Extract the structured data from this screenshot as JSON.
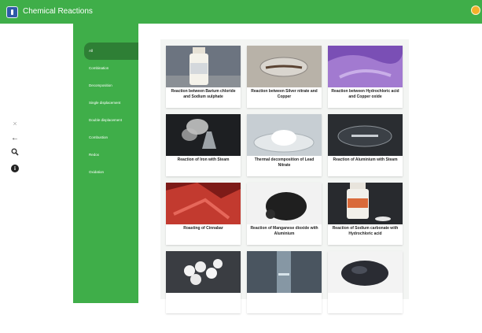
{
  "app": {
    "title": "Chemical Reactions",
    "colors": {
      "primary": "#3fae49",
      "active_item": "#2e7f35",
      "panel_bg": "#f3f5f3"
    }
  },
  "left_controls": [
    {
      "name": "close-icon",
      "symbol": "×"
    },
    {
      "name": "back-arrow-icon",
      "symbol": "←"
    },
    {
      "name": "search-icon",
      "symbol": "search"
    },
    {
      "name": "info-icon",
      "symbol": "i"
    }
  ],
  "categories": [
    {
      "label": "All",
      "active": true
    },
    {
      "label": "Combination",
      "active": false
    },
    {
      "label": "Decomposition",
      "active": false
    },
    {
      "label": "Single displacement",
      "active": false
    },
    {
      "label": "Double displacement",
      "active": false
    },
    {
      "label": "Combustion",
      "active": false
    },
    {
      "label": "Redox",
      "active": false
    },
    {
      "label": "Oxidation",
      "active": false
    }
  ],
  "reactions": [
    {
      "caption": "Reaction between Barium chloride and Sodium sulphate",
      "image": "barium-chloride-bottle"
    },
    {
      "caption": "Reaction between Silver nitrate and Copper",
      "image": "silver-nitrate-copper-dish"
    },
    {
      "caption": "Reaction between Hydrochloric acid and Copper oxide",
      "image": "purple-solution"
    },
    {
      "caption": "Reaction of Iron with Steam",
      "image": "steam-flask"
    },
    {
      "caption": "Thermal decomposition of Lead Nitrate",
      "image": "lead-nitrate-watch-glass"
    },
    {
      "caption": "Reaction of Aluminium with Steam",
      "image": "aluminium-dish"
    },
    {
      "caption": "Roasting of Cinnabar",
      "image": "cinnabar-red"
    },
    {
      "caption": "Reaction of Manganese dioxide with Aluminium",
      "image": "manganese-dioxide-powder"
    },
    {
      "caption": "Reaction of Sodium carbonate with Hydrochloric acid",
      "image": "sodium-carbonate-bottle"
    },
    {
      "caption": "",
      "image": "white-pellets"
    },
    {
      "caption": "",
      "image": "test-tube-liquid"
    },
    {
      "caption": "",
      "image": "dark-granules"
    }
  ]
}
